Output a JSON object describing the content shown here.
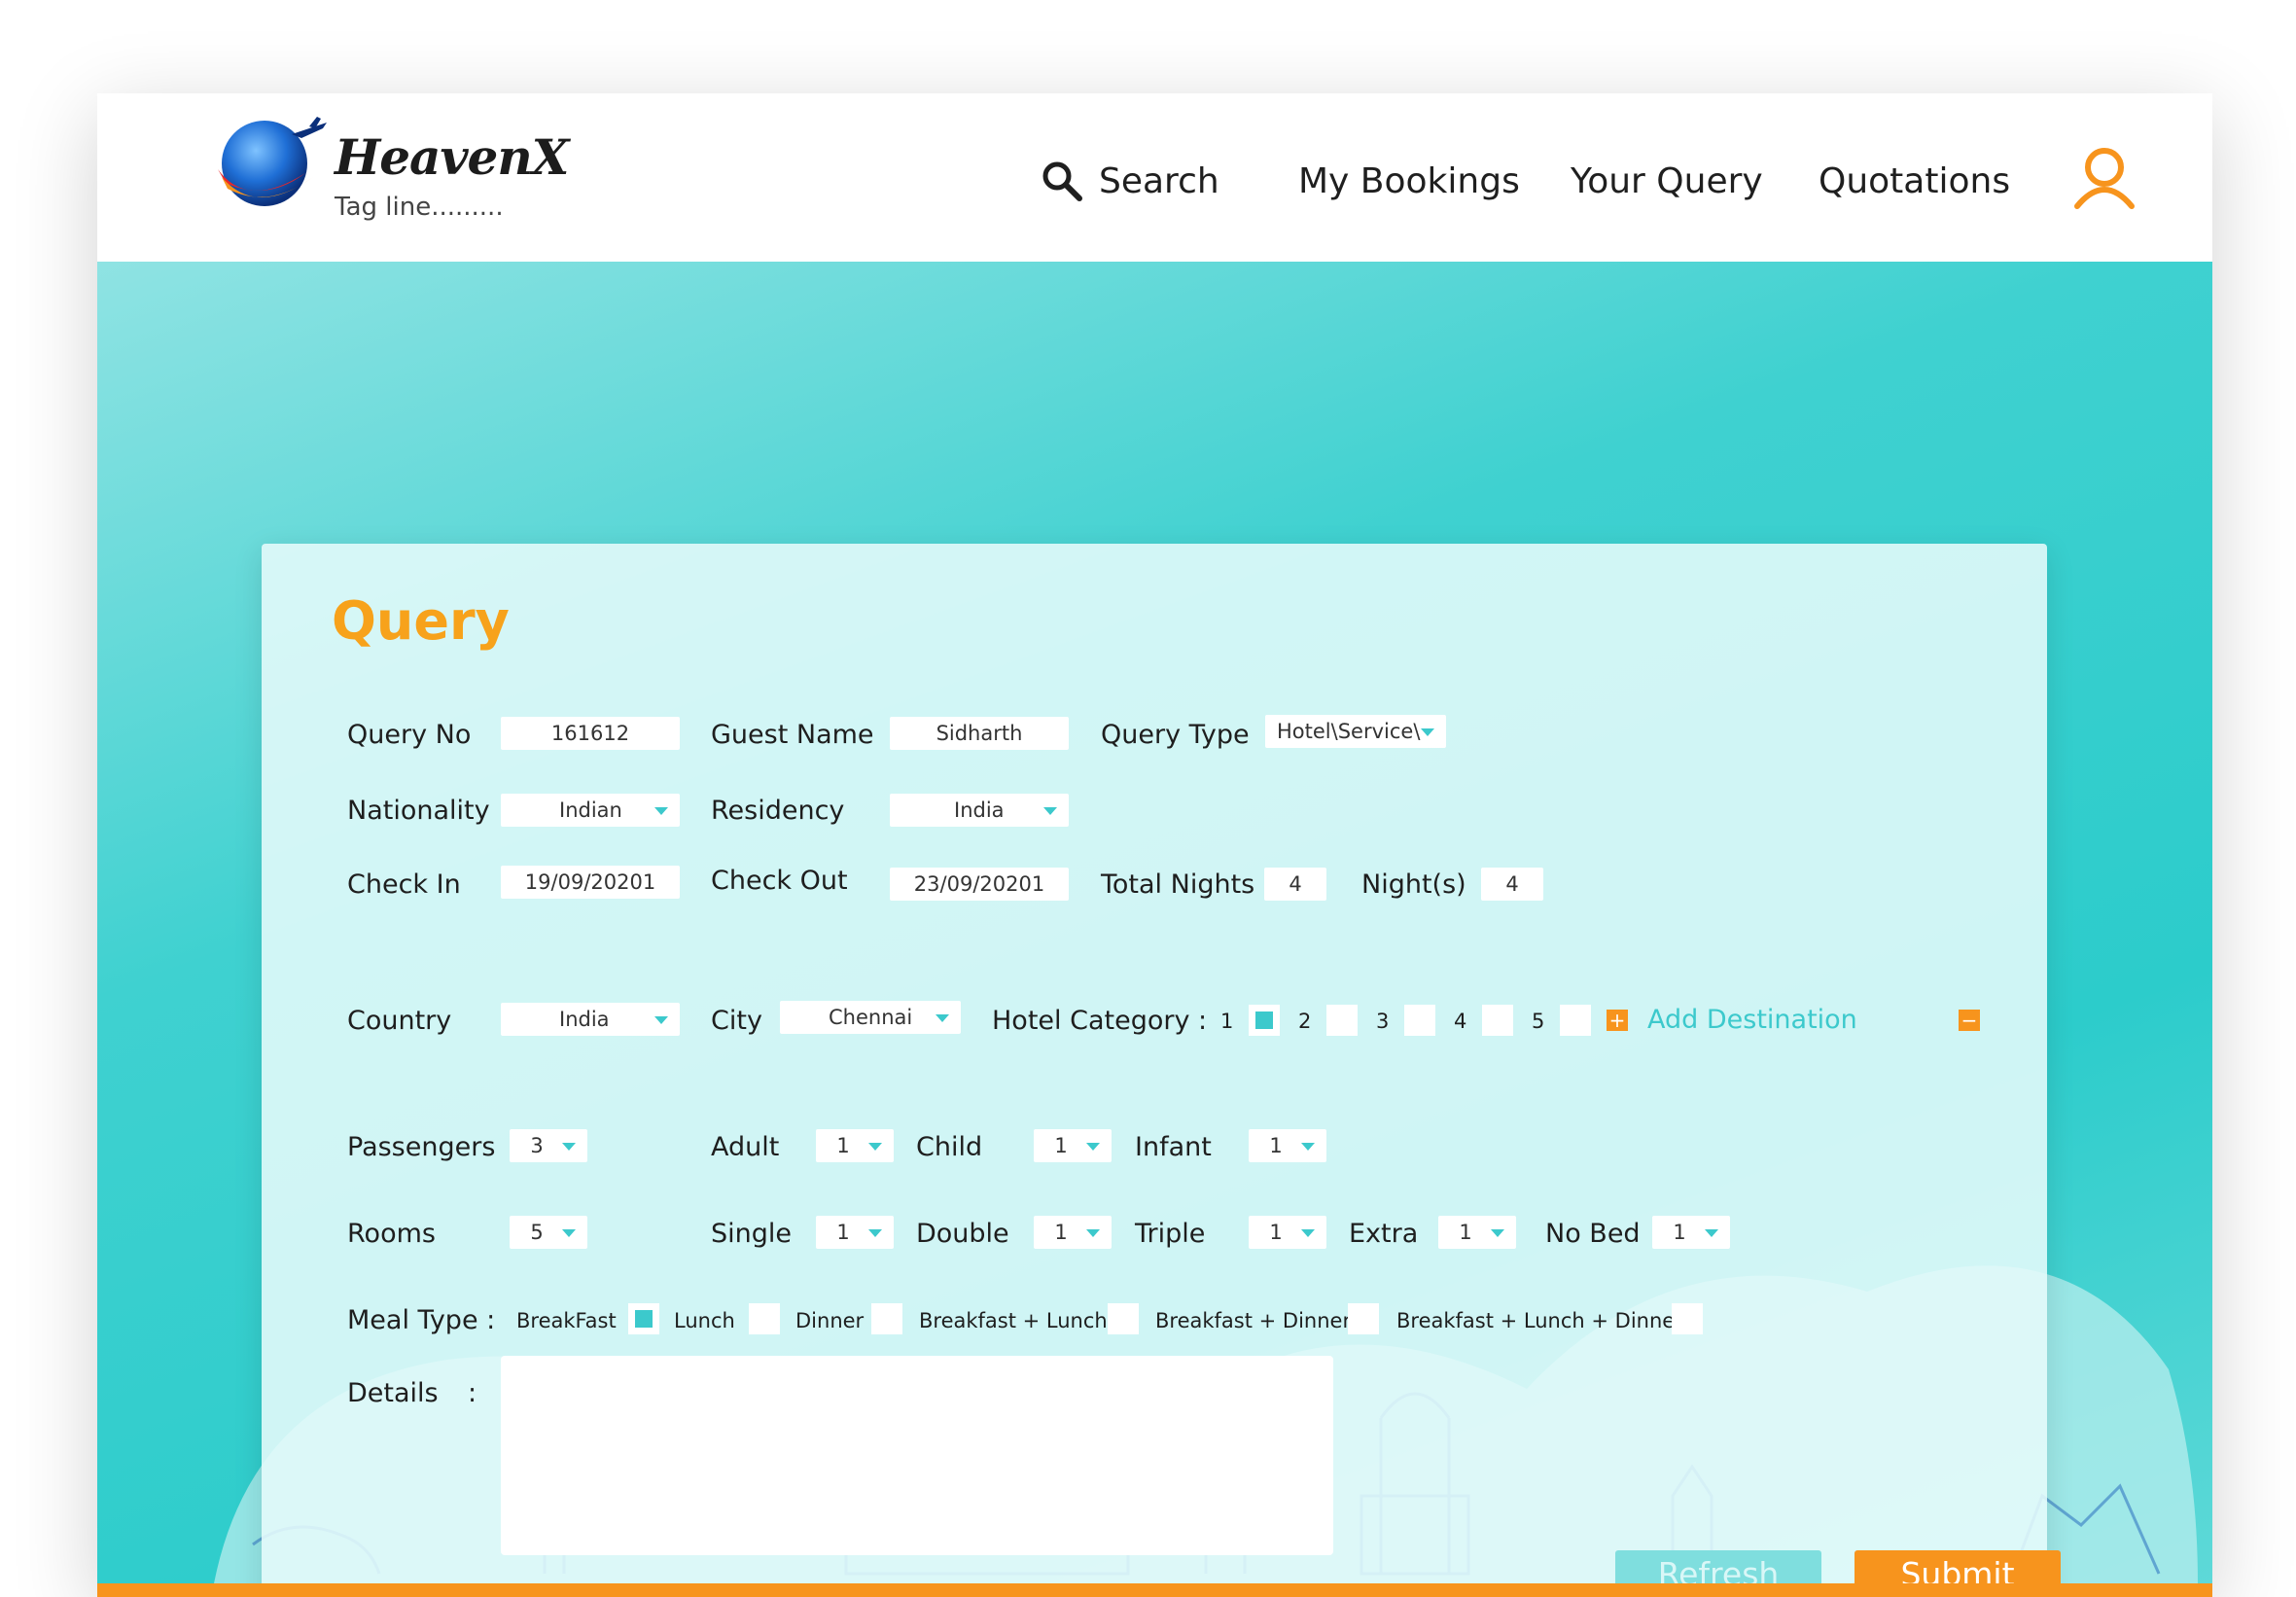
{
  "header": {
    "brand": "HeavenX",
    "tagline": "Tag line.........",
    "nav": {
      "search": "Search",
      "my_bookings": "My Bookings",
      "your_query": "Your Query",
      "quotations": "Quotations"
    }
  },
  "colors": {
    "accent_orange": "#f7941d",
    "accent_teal": "#3cc9cc",
    "hero_teal": "#2ccccb"
  },
  "form": {
    "title": "Query",
    "query_no": {
      "label": "Query No",
      "value": "161612"
    },
    "guest_name": {
      "label": "Guest Name",
      "value": "Sidharth"
    },
    "query_type": {
      "label": "Query Type",
      "value": "Hotel\\Service\\"
    },
    "nationality": {
      "label": "Nationality",
      "value": "Indian"
    },
    "residency": {
      "label": "Residency",
      "value": "India"
    },
    "check_in": {
      "label": "Check In",
      "value": "19/09/20201"
    },
    "check_out": {
      "label": "Check Out",
      "value": "23/09/20201"
    },
    "total_nights": {
      "label": "Total Nights",
      "value": "4"
    },
    "nights": {
      "label": "Night(s)",
      "value": "4"
    },
    "country": {
      "label": "Country",
      "value": "India"
    },
    "city": {
      "label": "City",
      "value": "Chennai"
    },
    "hotel_category": {
      "label": "Hotel Category :",
      "options": [
        {
          "label": "1",
          "checked": true
        },
        {
          "label": "2",
          "checked": false
        },
        {
          "label": "3",
          "checked": false
        },
        {
          "label": "4",
          "checked": false
        },
        {
          "label": "5",
          "checked": false
        }
      ]
    },
    "add_destination": "Add Destination",
    "plus_symbol": "+",
    "minus_symbol": "−",
    "passengers": {
      "label": "Passengers",
      "value": "3"
    },
    "adult": {
      "label": "Adult",
      "value": "1"
    },
    "child": {
      "label": "Child",
      "value": "1"
    },
    "infant": {
      "label": "Infant",
      "value": "1"
    },
    "rooms": {
      "label": "Rooms",
      "value": "5"
    },
    "single": {
      "label": "Single",
      "value": "1"
    },
    "double": {
      "label": "Double",
      "value": "1"
    },
    "triple": {
      "label": "Triple",
      "value": "1"
    },
    "extra": {
      "label": "Extra",
      "value": "1"
    },
    "no_bed": {
      "label": "No Bed",
      "value": "1"
    },
    "meal_type": {
      "label": "Meal Type :",
      "options": [
        {
          "label": "BreakFast",
          "checked": true
        },
        {
          "label": "Lunch",
          "checked": false
        },
        {
          "label": "Dinner",
          "checked": false
        },
        {
          "label": "Breakfast + Lunch",
          "checked": false
        },
        {
          "label": "Breakfast + Dinner",
          "checked": false
        },
        {
          "label": "Breakfast + Lunch + Dinner",
          "checked": false
        }
      ]
    },
    "details": {
      "label": "Details",
      "colon": ":",
      "value": ""
    },
    "refresh_label": "Refresh",
    "submit_label": "Submit"
  }
}
